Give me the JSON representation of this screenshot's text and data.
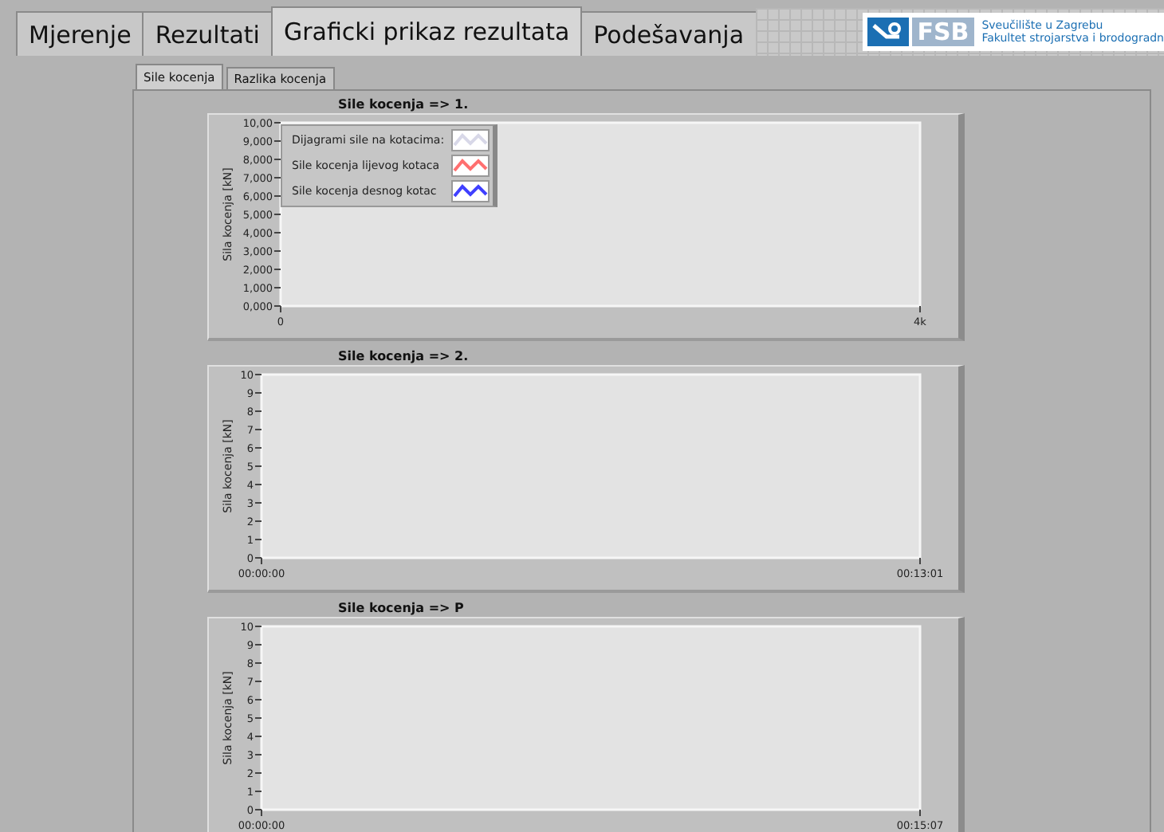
{
  "tabs": [
    {
      "label": "Mjerenje",
      "selected": false
    },
    {
      "label": "Rezultati",
      "selected": false
    },
    {
      "label": "Graficki prikaz rezultata",
      "selected": true
    },
    {
      "label": "Podešavanja",
      "selected": false
    }
  ],
  "logo": {
    "mark": "FSB",
    "line_1": "Sveučilište u Zagrebu",
    "line_2": "Fakultet strojarstva i brodogradn"
  },
  "subtabs": [
    {
      "label": "Sile kocenja",
      "selected": true
    },
    {
      "label": "Razlika kocenja",
      "selected": false
    }
  ],
  "charts": [
    {
      "legend": [
        {
          "label": "Dijagrami sile na kotacima:",
          "color": "#d8d8e8"
        },
        {
          "label": "Sile kocenja lijevog kotaca",
          "color": "#ff7070"
        },
        {
          "label": "Sile kocenja desnog kotac",
          "color": "#4040ff"
        }
      ],
      "chart_data": {
        "type": "line",
        "title": "Sile kocenja => 1.",
        "ylabel": "Sila kocenja [kN]",
        "ylim": [
          0,
          10
        ],
        "yticks": [
          {
            "value": 10,
            "label": "10,00"
          },
          {
            "value": 9,
            "label": "9,000"
          },
          {
            "value": 8,
            "label": "8,000"
          },
          {
            "value": 7,
            "label": "7,000"
          },
          {
            "value": 6,
            "label": "6,000"
          },
          {
            "value": 5,
            "label": "5,000"
          },
          {
            "value": 4,
            "label": "4,000"
          },
          {
            "value": 3,
            "label": "3,000"
          },
          {
            "value": 2,
            "label": "2,000"
          },
          {
            "value": 1,
            "label": "1,000"
          },
          {
            "value": 0,
            "label": "0,000"
          }
        ],
        "xlim": [
          0,
          4000
        ],
        "xticks": [
          {
            "value": 0,
            "label": "0"
          },
          {
            "value": 4000,
            "label": "4k"
          }
        ]
      }
    },
    {
      "chart_data": {
        "type": "line",
        "title": "Sile kocenja => 2.",
        "ylabel": "Sila kocenja [kN]",
        "ylim": [
          0,
          10
        ],
        "yticks": [
          {
            "value": 10,
            "label": "10"
          },
          {
            "value": 9,
            "label": "9"
          },
          {
            "value": 8,
            "label": "8"
          },
          {
            "value": 7,
            "label": "7"
          },
          {
            "value": 6,
            "label": "6"
          },
          {
            "value": 5,
            "label": "5"
          },
          {
            "value": 4,
            "label": "4"
          },
          {
            "value": 3,
            "label": "3"
          },
          {
            "value": 2,
            "label": "2"
          },
          {
            "value": 1,
            "label": "1"
          },
          {
            "value": 0,
            "label": "0"
          }
        ],
        "xlim": [
          0,
          781
        ],
        "xticks": [
          {
            "value": 0,
            "label": "00:00:00"
          },
          {
            "value": 781,
            "label": "00:13:01"
          }
        ]
      }
    },
    {
      "chart_data": {
        "type": "line",
        "title": "Sile kocenja => P",
        "ylabel": "Sila kocenja [kN]",
        "ylim": [
          0,
          10
        ],
        "yticks": [
          {
            "value": 10,
            "label": "10"
          },
          {
            "value": 9,
            "label": "9"
          },
          {
            "value": 8,
            "label": "8"
          },
          {
            "value": 7,
            "label": "7"
          },
          {
            "value": 6,
            "label": "6"
          },
          {
            "value": 5,
            "label": "5"
          },
          {
            "value": 4,
            "label": "4"
          },
          {
            "value": 3,
            "label": "3"
          },
          {
            "value": 2,
            "label": "2"
          },
          {
            "value": 1,
            "label": "1"
          },
          {
            "value": 0,
            "label": "0"
          }
        ],
        "xlim": [
          0,
          907
        ],
        "xticks": [
          {
            "value": 0,
            "label": "00:00:00"
          },
          {
            "value": 907,
            "label": "00:15:07"
          }
        ]
      }
    }
  ]
}
